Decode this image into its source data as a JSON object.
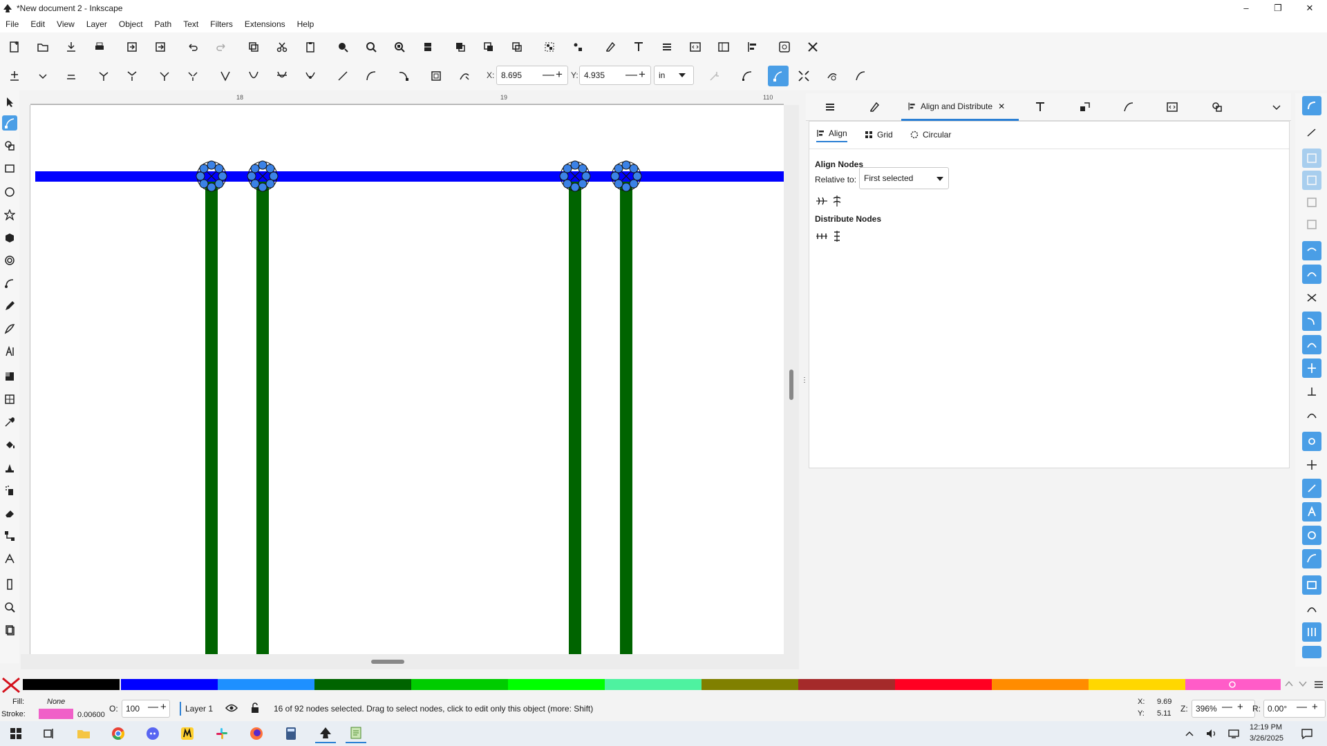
{
  "window": {
    "title": "*New document 2 - Inkscape",
    "minimize": "–",
    "restore": "❐",
    "close": "✕"
  },
  "menu": [
    "File",
    "Edit",
    "View",
    "Layer",
    "Object",
    "Path",
    "Text",
    "Filters",
    "Extensions",
    "Help"
  ],
  "node_toolbar": {
    "x_label": "X:",
    "x_value": "8.695",
    "y_label": "Y:",
    "y_value": "4.935",
    "unit": "in"
  },
  "ruler": {
    "mark_18": "18",
    "mark_19": "19",
    "mark_110": "110"
  },
  "dock": {
    "active_tab": "Align and Distribute",
    "sub_tabs": [
      "Align",
      "Grid",
      "Circular"
    ],
    "align_nodes_heading": "Align Nodes",
    "relative_to_label": "Relative to:",
    "relative_to_value": "First selected",
    "distribute_nodes_heading": "Distribute Nodes"
  },
  "status": {
    "fill_label": "Fill:",
    "fill_value": "None",
    "stroke_label": "Stroke:",
    "stroke_width": "0.00600",
    "opacity_label": "O:",
    "opacity_value": "100",
    "layer": "Layer 1",
    "message": "16 of 92 nodes selected. Drag to select nodes, click to edit only this object (more: Shift)",
    "cursor_x_label": "X:",
    "cursor_x": "9.69",
    "cursor_y_label": "Y:",
    "cursor_y": "5.11",
    "zoom_label": "Z:",
    "zoom": "396%",
    "rotate_label": "R:",
    "rotate": "0.00°"
  },
  "taskbar": {
    "time": "12:19 PM",
    "date": "3/26/2025"
  },
  "colors": {
    "blue_path": "#0000ff",
    "green_path": "#006400",
    "node_fill": "#3b82e6",
    "accent": "#4a9ee6"
  },
  "palette": [
    "#000000",
    "#0000ff",
    "#1e90ff",
    "#006400",
    "#00cc00",
    "#00ff00",
    "#4ef2a0",
    "#808000",
    "#a52a2a",
    "#ff0022",
    "#ff8c00",
    "#ffd700",
    "#ff5cc8"
  ]
}
